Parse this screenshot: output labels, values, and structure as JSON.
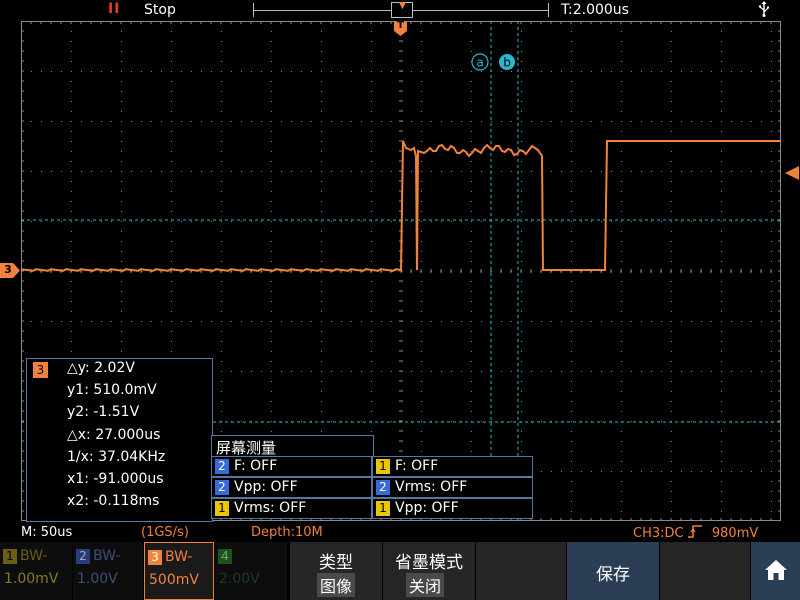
{
  "status": {
    "run_icon": "II",
    "state": "Stop"
  },
  "topbar": {
    "delay": "T:2.000us",
    "usb_icon": "usb-icon"
  },
  "info": {
    "timebase": "M: 50us",
    "sample_rate": "(1GS/s)",
    "depth": "Depth:10M",
    "trigger": "CH3:DC",
    "trigger_edge_icon": "rising-edge-icon",
    "trigger_level": "980mV"
  },
  "channels": [
    {
      "num": "1",
      "bw": "BW-",
      "volts": "1.00mV",
      "color": "#e8c700",
      "active": false
    },
    {
      "num": "2",
      "bw": "BW-",
      "volts": "1.00V",
      "color": "#3a6ad8",
      "active": false
    },
    {
      "num": "3",
      "bw": "BW-",
      "volts": "500mV",
      "color": "#f0823c",
      "active": true
    },
    {
      "num": "4",
      "bw": "",
      "volts": "2.00V",
      "color": "#2f8f2f",
      "active": false
    }
  ],
  "menu": {
    "type_label": "类型",
    "type_value": "图像",
    "ink_label": "省墨模式",
    "ink_value": "关闭",
    "save_label": "保存",
    "home_icon": "home-icon"
  },
  "cursor": {
    "channel": "3",
    "dy": "△y: 2.02V",
    "y1": "y1: 510.0mV",
    "y2": "y2: -1.51V",
    "dx": "△x: 27.000us",
    "inv_dx": "1/x: 37.04KHz",
    "x1": "x1: -91.000us",
    "x2": "x2: -0.118ms",
    "label_a": "a",
    "label_b": "b"
  },
  "measure": {
    "title": "屏幕测量",
    "items": [
      {
        "ch": "2",
        "text": "F: OFF",
        "color": "#3a6ad8"
      },
      {
        "ch": "1",
        "text": "F: OFF",
        "color": "#e8c700"
      },
      {
        "ch": "2",
        "text": "Vpp: OFF",
        "color": "#3a6ad8"
      },
      {
        "ch": "2",
        "text": "Vrms: OFF",
        "color": "#3a6ad8"
      },
      {
        "ch": "1",
        "text": "Vrms: OFF",
        "color": "#e8c700"
      },
      {
        "ch": "1",
        "text": "Vpp: OFF",
        "color": "#e8c700"
      }
    ]
  },
  "markers": {
    "trigger_pos": "T",
    "ch3_marker": "3"
  },
  "colors": {
    "ch3": "#f0823c",
    "cursor": "#27b9cc",
    "grid": "#8a8a8a"
  }
}
